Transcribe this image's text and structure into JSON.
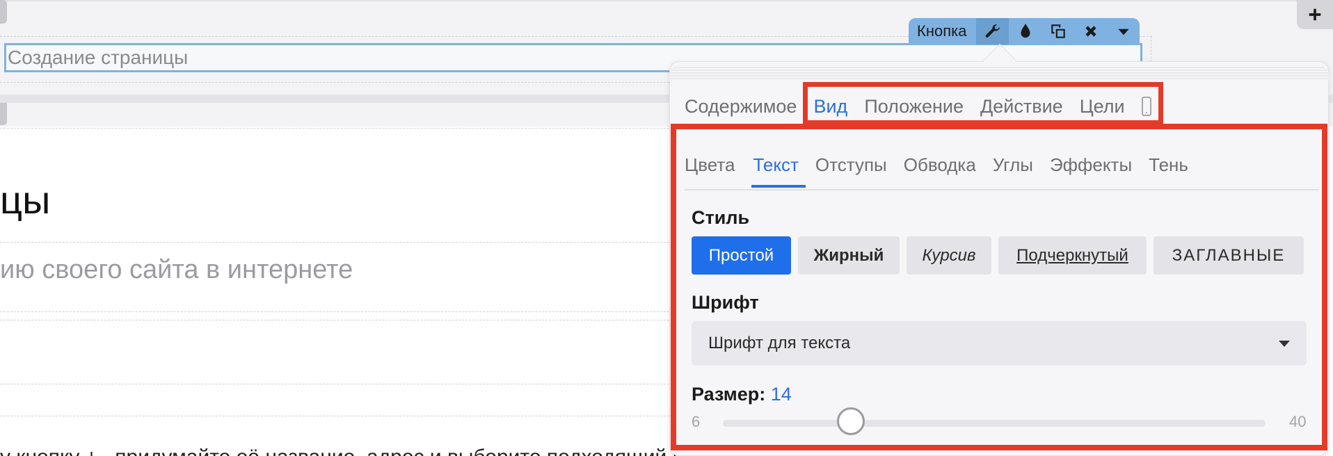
{
  "editor": {
    "input_value": "Создание страницы",
    "heading_fragment": "цы",
    "subtitle_fragment": "ию своего сайта в интернете",
    "bottom_fragment": "у кнопку  +  , придумайте её название, адрес и выберите подходящий шаблон"
  },
  "toolbar": {
    "label": "Кнопка",
    "buttons": [
      {
        "name": "wrench-icon",
        "active": true
      },
      {
        "name": "drop-icon",
        "active": false
      },
      {
        "name": "duplicate-icon",
        "active": false
      },
      {
        "name": "close-icon",
        "active": false
      },
      {
        "name": "caret-down-icon",
        "active": false
      }
    ]
  },
  "add_button_icon": "plus-icon",
  "popup": {
    "main_tabs": [
      "Содержимое",
      "Вид",
      "Положение",
      "Действие",
      "Цели"
    ],
    "main_active": 1,
    "mobile_icon": "phone-icon",
    "sub_tabs": [
      "Цвета",
      "Текст",
      "Отступы",
      "Обводка",
      "Углы",
      "Эффекты",
      "Тень"
    ],
    "sub_active": 1,
    "style": {
      "label": "Стиль",
      "options": [
        "Простой",
        "Жирный",
        "Курсив",
        "Подчеркнутый",
        "ЗАГЛАВНЫЕ"
      ],
      "selected": 0
    },
    "font": {
      "label": "Шрифт",
      "value": "Шрифт для текста"
    },
    "size": {
      "label": "Размер:",
      "value": 14,
      "min": 6,
      "max": 40
    }
  },
  "colors": {
    "accent": "#1f6fea",
    "highlight_border": "#e43b28",
    "toolbar_bg": "#7fb2e0"
  }
}
